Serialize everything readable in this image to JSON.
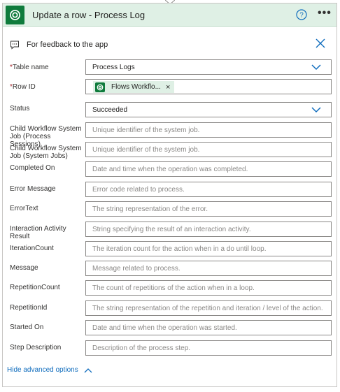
{
  "header": {
    "title": "Update a row - Process Log",
    "accent": "#0f7b3c"
  },
  "feedback": {
    "text": "For feedback to the app"
  },
  "fields": {
    "table_name": {
      "label": "Table name",
      "value": "Process Logs"
    },
    "row_id": {
      "label": "Row ID",
      "token": "Flows Workflo..."
    },
    "status": {
      "label": "Status",
      "value": "Succeeded"
    },
    "child_process_sessions": {
      "label": "Child Workflow System Job (Process Sessions)",
      "placeholder": "Unique identifier of the system job."
    },
    "child_system_jobs": {
      "label": "Child Workflow System Job (System Jobs)",
      "placeholder": "Unique identifier of the system job."
    },
    "completed_on": {
      "label": "Completed On",
      "placeholder": "Date and time when the operation was completed."
    },
    "error_message": {
      "label": "Error Message",
      "placeholder": "Error code related to process."
    },
    "error_text": {
      "label": "ErrorText",
      "placeholder": "The string representation of the error."
    },
    "interaction_result": {
      "label": "Interaction Activity Result",
      "placeholder": "String specifying the result of an interaction activity."
    },
    "iteration_count": {
      "label": "IterationCount",
      "placeholder": "The iteration count for the action when in a do until loop."
    },
    "message": {
      "label": "Message",
      "placeholder": "Message related to process."
    },
    "repetition_count": {
      "label": "RepetitionCount",
      "placeholder": "The count of repetitions of the action when in a loop."
    },
    "repetition_id": {
      "label": "RepetitionId",
      "placeholder": "The string representation of the repetition and iteration / level of the action."
    },
    "started_on": {
      "label": "Started On",
      "placeholder": "Date and time when the operation was started."
    },
    "step_description": {
      "label": "Step Description",
      "placeholder": "Description of the process step."
    }
  },
  "advanced": {
    "label": "Hide advanced options"
  },
  "required_marker": "*",
  "token_remove": "×"
}
